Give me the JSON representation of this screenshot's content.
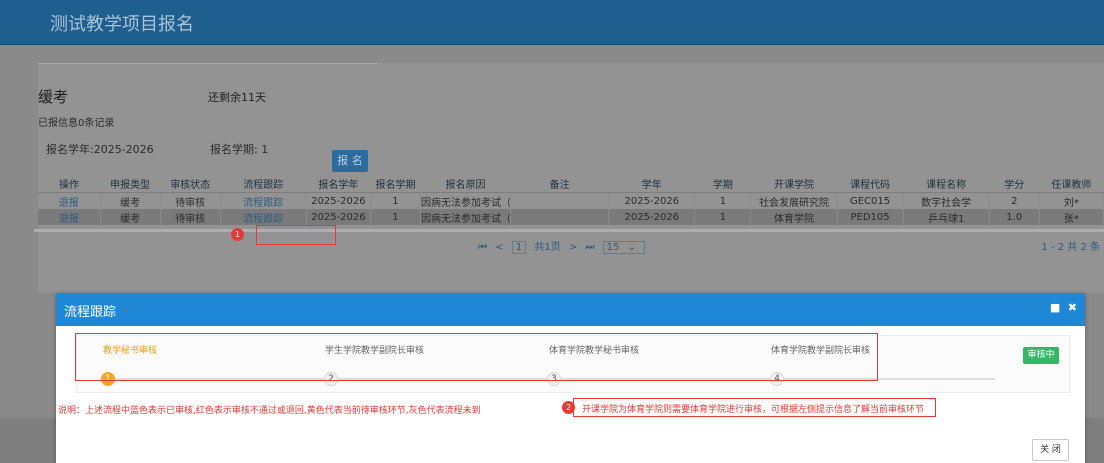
{
  "app": {
    "title": "测试教学项目报名"
  },
  "panel": {
    "type_title": "缓考",
    "remaining": "还剩余11天",
    "reported": "已报信息0条记录",
    "year_filter": "报名学年:2025-2026",
    "term_filter": "报名学期: 1",
    "sign_button": "报 名"
  },
  "table": {
    "headers": [
      "操作",
      "申报类型",
      "审核状态",
      "流程跟踪",
      "报名学年",
      "报名学期",
      "报名原因",
      "备注",
      "学年",
      "学期",
      "开课学院",
      "课程代码",
      "课程名称",
      "学分",
      "任课教师"
    ],
    "rows": [
      [
        "退报",
        "缓考",
        "待审核",
        "流程跟踪",
        "2025-2026",
        "1",
        "因病无法参加考试（测试",
        "",
        "2025-2026",
        "1",
        "社会发展研究院",
        "GEC015",
        "数字社会学",
        "2",
        "刘*"
      ],
      [
        "退报",
        "缓考",
        "待审核",
        "流程跟踪",
        "2025-2026",
        "1",
        "因病无法参加考试（测试",
        "",
        "2025-2026",
        "1",
        "体育学院",
        "PED105",
        "乒乓球1",
        "1.0",
        "张*"
      ]
    ]
  },
  "pager": {
    "first": "⏮",
    "prev": "<",
    "page": "1",
    "total_pages": "共1页",
    "next": ">",
    "last": "⏭",
    "page_size": "15",
    "summary": "1 - 2   共 2 条"
  },
  "markers": {
    "m1": "1",
    "m2": "2"
  },
  "modal": {
    "title": "流程跟踪",
    "steps": [
      {
        "label": "教学秘书审核",
        "num": "1",
        "state": "current"
      },
      {
        "label": "学生学院教学副院长审核",
        "num": "2",
        "state": "pending"
      },
      {
        "label": "体育学院教学秘书审核",
        "num": "3",
        "state": "pending"
      },
      {
        "label": "体育学院教学副院长审核",
        "num": "4",
        "state": "pending"
      }
    ],
    "status": "审核中",
    "description": "说明：上述流程中蓝色表示已审核,红色表示审核不通过或退回,黄色代表当前待审核环节,灰色代表流程未到",
    "hint": "开课学院为体育学院则需要体育学院进行审核，可根据左侧提示信息了解当前审核环节",
    "close_button": "关 闭"
  },
  "colors": {
    "header_bar": "#1f5f8f",
    "modal_header": "#1e88d6",
    "active_step": "#f5a623",
    "annotation_red": "#e53935",
    "status_green": "#34b767"
  }
}
